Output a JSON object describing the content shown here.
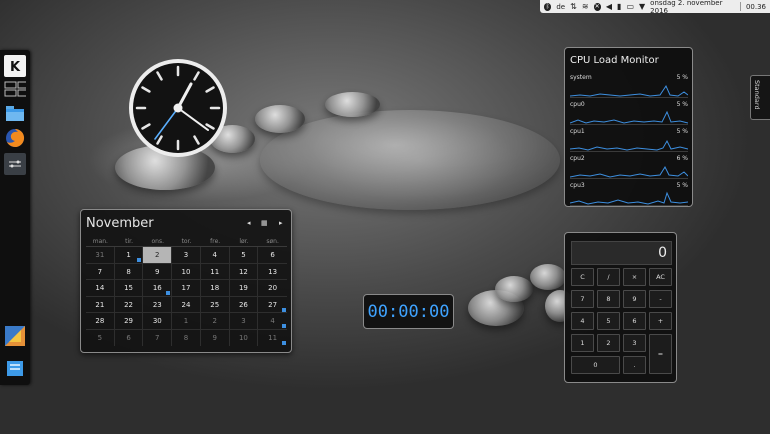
{
  "top_panel": {
    "language": "de",
    "datetime": "onsdag 2. november 2016",
    "time": "00.36",
    "icons": [
      "bluetooth-icon",
      "network-icon",
      "wifi-icon",
      "device-icon",
      "volume-icon",
      "battery-icon",
      "clipboard-icon",
      "notifications-icon"
    ]
  },
  "dock": {
    "icons": [
      "kde-logo-icon",
      "desktop-grid-icon",
      "folder-icon",
      "firefox-icon",
      "kde-connect-icon",
      "kate-editor-icon",
      "file-manager-icon"
    ]
  },
  "calendar": {
    "title": "November",
    "nav": {
      "prev": "◂",
      "today": "▦",
      "next": "▸"
    },
    "weekdays": [
      "man.",
      "tir.",
      "ons.",
      "tor.",
      "fre.",
      "lør.",
      "søn."
    ],
    "weeks": [
      [
        "31",
        "1",
        "2",
        "3",
        "4",
        "5",
        "6"
      ],
      [
        "7",
        "8",
        "9",
        "10",
        "11",
        "12",
        "13"
      ],
      [
        "14",
        "15",
        "16",
        "17",
        "18",
        "19",
        "20"
      ],
      [
        "21",
        "22",
        "23",
        "24",
        "25",
        "26",
        "27"
      ],
      [
        "28",
        "29",
        "30",
        "1",
        "2",
        "3",
        "4"
      ],
      [
        "5",
        "6",
        "7",
        "8",
        "9",
        "10",
        "11"
      ]
    ]
  },
  "digital_clock": {
    "value": "00:00:00"
  },
  "cpu_monitor": {
    "title": "CPU Load Monitor",
    "rows": [
      {
        "label": "system",
        "value": "5 %"
      },
      {
        "label": "cpu0",
        "value": "5 %"
      },
      {
        "label": "cpu1",
        "value": "5 %"
      },
      {
        "label": "cpu2",
        "value": "6 %"
      },
      {
        "label": "cpu3",
        "value": "5 %"
      }
    ],
    "line_color": "#3d8fe0"
  },
  "calculator": {
    "display": "0",
    "buttons": [
      [
        "C",
        "/",
        "×",
        "AC"
      ],
      [
        "7",
        "8",
        "9",
        "-"
      ],
      [
        "4",
        "5",
        "6",
        "+"
      ],
      [
        "1",
        "2",
        "3",
        "="
      ],
      [
        "0",
        ".",
        "",
        ""
      ]
    ]
  },
  "standard_tab": {
    "label": "Standard"
  },
  "colors": {
    "accent": "#3fa3ff",
    "today_bg": "#b5b5b5"
  }
}
